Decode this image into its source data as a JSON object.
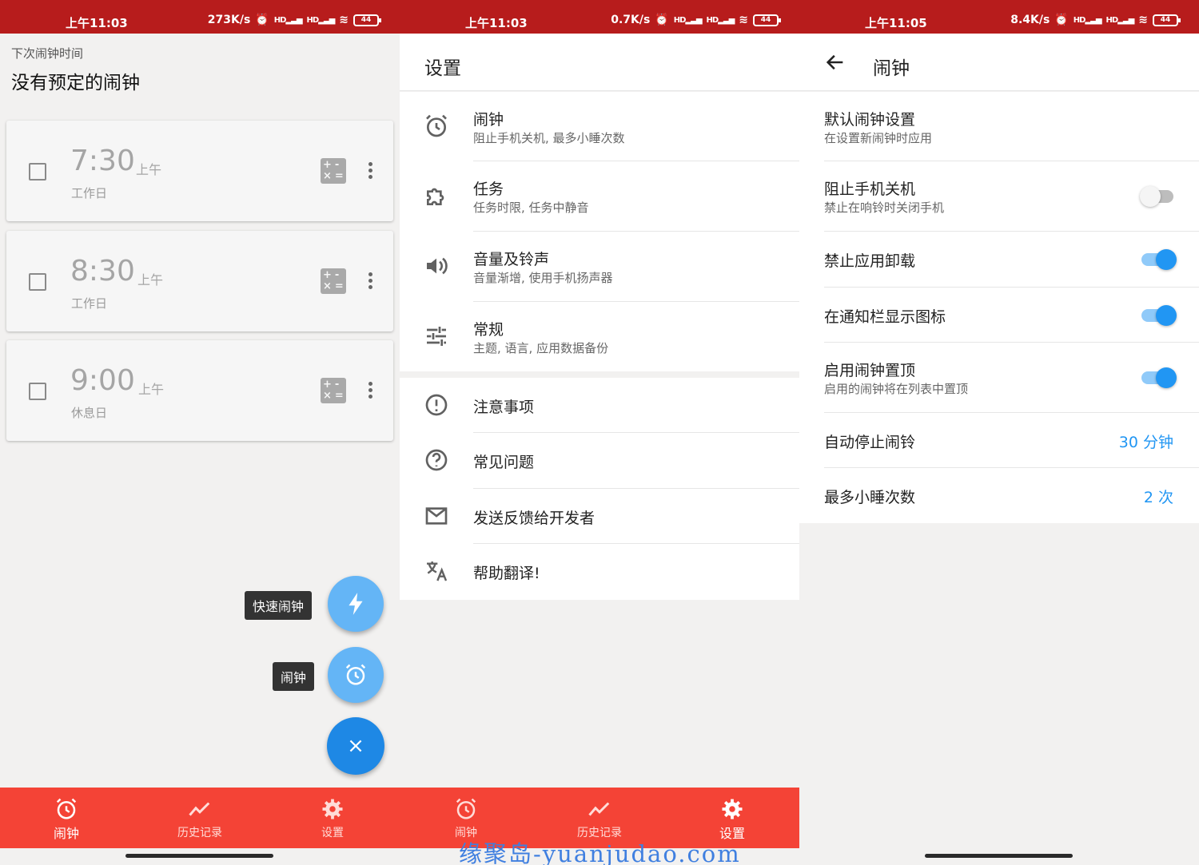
{
  "colors": {
    "status_bar": "#b71c1c",
    "bottom_nav": "#f44336",
    "accent": "#2196f3",
    "fab_mini": "#64b5f6",
    "fab_main": "#1e88e5"
  },
  "panel1": {
    "status": {
      "time": "上午11:03",
      "speed": "273K/s",
      "battery": "44"
    },
    "next_alarm_label": "下次闹钟时间",
    "next_alarm_value": "没有预定的闹钟",
    "alarms": [
      {
        "time": "7:30",
        "ampm": "上午",
        "days": "工作日"
      },
      {
        "time": "8:30",
        "ampm": "上午",
        "days": "工作日"
      },
      {
        "time": "9:00",
        "ampm": "上午",
        "days": "休息日"
      }
    ],
    "calc_icon_text": "+-\n×=",
    "fab": {
      "quick_alarm_label": "快速闹钟",
      "alarm_label": "闹钟",
      "close_symbol": "×"
    },
    "nav": [
      {
        "label": "闹钟",
        "icon": "alarm-clock-icon",
        "active": true
      },
      {
        "label": "历史记录",
        "icon": "trend-chart-icon",
        "active": false
      },
      {
        "label": "设置",
        "icon": "gear-icon",
        "active": false
      }
    ]
  },
  "panel2": {
    "status": {
      "time": "上午11:03",
      "speed": "0.7K/s",
      "battery": "44"
    },
    "title": "设置",
    "group1": [
      {
        "title": "闹钟",
        "subtitle": "阻止手机关机, 最多小睡次数",
        "icon": "alarm-clock-icon"
      },
      {
        "title": "任务",
        "subtitle": "任务时限, 任务中静音",
        "icon": "puzzle-icon"
      },
      {
        "title": "音量及铃声",
        "subtitle": "音量渐增, 使用手机扬声器",
        "icon": "volume-icon"
      },
      {
        "title": "常规",
        "subtitle": "主题, 语言, 应用数据备份",
        "icon": "sliders-icon"
      }
    ],
    "group2": [
      {
        "title": "注意事项",
        "icon": "exclamation-icon"
      },
      {
        "title": "常见问题",
        "icon": "question-icon"
      },
      {
        "title": "发送反馈给开发者",
        "icon": "mail-icon"
      },
      {
        "title": "帮助翻译!",
        "icon": "translate-icon"
      }
    ],
    "nav": [
      {
        "label": "闹钟",
        "icon": "alarm-clock-icon",
        "active": false
      },
      {
        "label": "历史记录",
        "icon": "trend-chart-icon",
        "active": false
      },
      {
        "label": "设置",
        "icon": "gear-icon",
        "active": true
      }
    ]
  },
  "panel3": {
    "status": {
      "time": "上午11:05",
      "speed": "8.4K/s",
      "battery": "44"
    },
    "title": "闹钟",
    "prefs": [
      {
        "title": "默认闹钟设置",
        "subtitle": "在设置新闹钟时应用"
      },
      {
        "title": "阻止手机关机",
        "subtitle": "禁止在响铃时关闭手机",
        "toggle": false
      },
      {
        "title": "禁止应用卸载",
        "toggle": true
      },
      {
        "title": "在通知栏显示图标",
        "toggle": true
      },
      {
        "title": "启用闹钟置顶",
        "subtitle": "启用的闹钟将在列表中置顶",
        "toggle": true
      },
      {
        "title": "自动停止闹铃",
        "value": "30 分钟"
      },
      {
        "title": "最多小睡次数",
        "value": "2 次"
      }
    ]
  },
  "watermark": "缘聚岛-yuanjudao.com"
}
